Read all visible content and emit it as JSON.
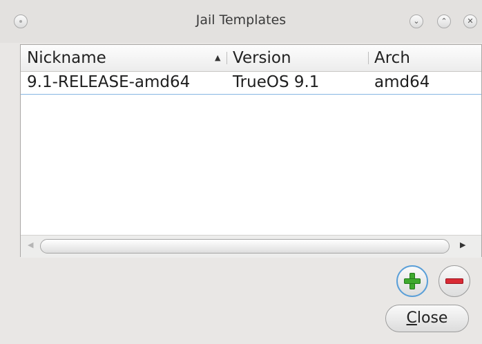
{
  "window": {
    "title": "Jail Templates",
    "controls": {
      "minimize_glyph": "⌄",
      "maximize_glyph": "⌃",
      "close_glyph": "✕"
    }
  },
  "table": {
    "columns": [
      "Nickname",
      "Version",
      "Arch"
    ],
    "sort_indicator": "▲",
    "rows": [
      {
        "nickname": "9.1-RELEASE-amd64",
        "version": "TrueOS 9.1",
        "arch": "amd64"
      }
    ],
    "scrollbar": {
      "left_arrow": "◀",
      "right_arrow": "▶"
    }
  },
  "buttons": {
    "add_icon": "plus-icon",
    "remove_icon": "minus-icon",
    "close_mnemonic": "C",
    "close_rest": "lose"
  },
  "colors": {
    "add_green": "#3fa92e",
    "remove_red": "#d92b35",
    "focus_blue": "#5a9fd8",
    "selection_line": "#86b5e3"
  }
}
